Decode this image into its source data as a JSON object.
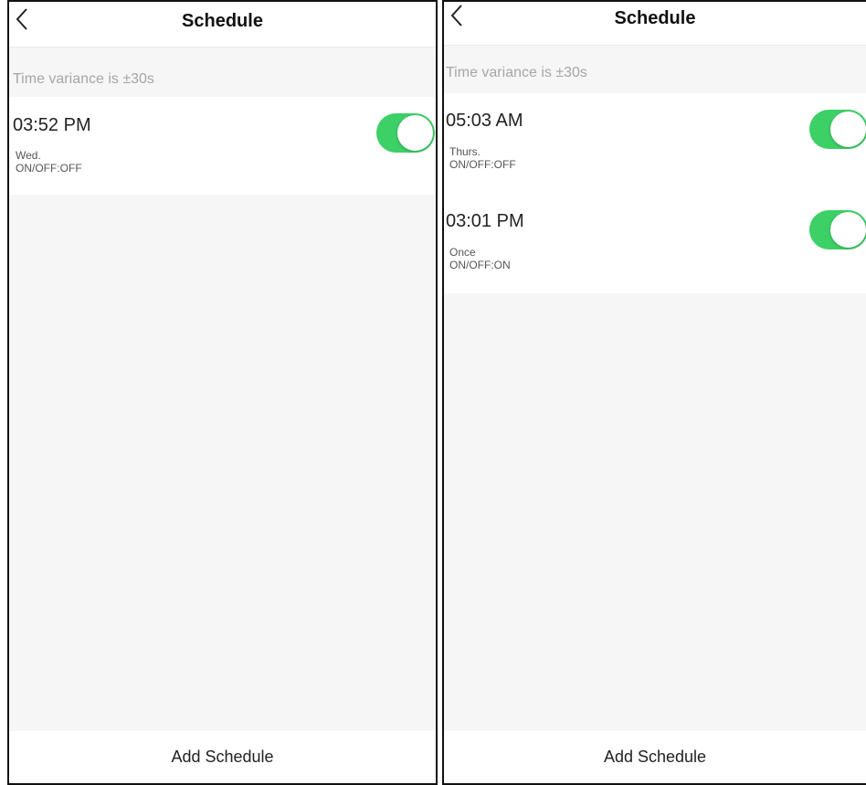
{
  "accent_color": "#3dd067",
  "screens": [
    {
      "header": {
        "back_icon": "chevron-left-icon",
        "title": "Schedule"
      },
      "variance_text": "Time variance is  ±30s",
      "schedules": [
        {
          "time": "03:52 PM",
          "repeat": "Wed.",
          "action": "ON/OFF:OFF",
          "enabled": true
        }
      ],
      "footer_label": "Add Schedule"
    },
    {
      "header": {
        "back_icon": "chevron-left-icon",
        "title": "Schedule"
      },
      "variance_text": "Time variance is  ±30s",
      "schedules": [
        {
          "time": "05:03 AM",
          "repeat": "Thurs.",
          "action": "ON/OFF:OFF",
          "enabled": true
        },
        {
          "time": "03:01 PM",
          "repeat": "Once",
          "action": "ON/OFF:ON",
          "enabled": true
        }
      ],
      "footer_label": "Add Schedule"
    }
  ]
}
